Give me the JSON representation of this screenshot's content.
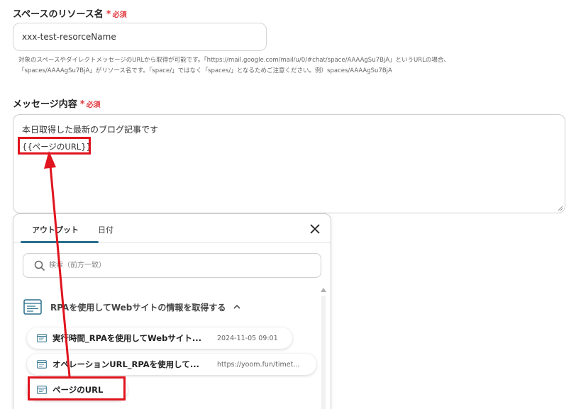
{
  "space_field": {
    "label": "スペースのリソース名",
    "required_star": "*",
    "required_text": "必須",
    "value": "xxx-test-resorceName",
    "help_line1": "対象のスペースやダイレクトメッセージのURLから取得が可能です。「https://mail.google.com/mail/u/0/#chat/space/AAAAgSu7BjA」というURLの場合、",
    "help_line2": "「spaces/AAAAgSu7BjA」がリソース名です。「space/」ではなく「spaces/」となるためご注意ください。例）spaces/AAAAgSu7BjA"
  },
  "message_field": {
    "label": "メッセージ内容",
    "required_star": "*",
    "required_text": "必須",
    "line1": "本日取得した最新のブログ記事です",
    "line2": "{{ページのURL}}"
  },
  "popup": {
    "tabs": [
      {
        "label": "アウトプット",
        "active": true
      },
      {
        "label": "日付",
        "active": false
      }
    ],
    "search_placeholder": "検索（前方一致）",
    "group_title": "RPAを使用してWebサイトの情報を取得する",
    "items": [
      {
        "label": "実行時間_RPAを使用してWebサイト...",
        "value": "2024-11-05 09:01"
      },
      {
        "label": "オペレーションURL_RPAを使用して...",
        "value": "https://yoom.fun/timet..."
      },
      {
        "label": "ページのURL",
        "value": ""
      }
    ]
  },
  "colors": {
    "required": "#e0383e",
    "highlight": "#e0141e",
    "tab_underline": "#2a6f8a"
  }
}
